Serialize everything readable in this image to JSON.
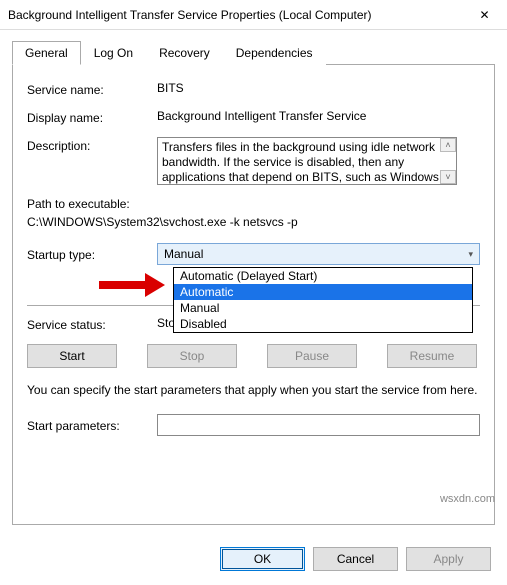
{
  "window": {
    "title": "Background Intelligent Transfer Service Properties (Local Computer)"
  },
  "tabs": {
    "general": "General",
    "logon": "Log On",
    "recovery": "Recovery",
    "dependencies": "Dependencies"
  },
  "labels": {
    "service_name": "Service name:",
    "display_name": "Display name:",
    "description": "Description:",
    "path_to_exe": "Path to executable:",
    "startup_type": "Startup type:",
    "service_status": "Service status:",
    "start_params": "Start parameters:"
  },
  "values": {
    "service_name": "BITS",
    "display_name": "Background Intelligent Transfer Service",
    "description": "Transfers files in the background using idle network bandwidth. If the service is disabled, then any applications that depend on BITS, such as Windows",
    "path": "C:\\WINDOWS\\System32\\svchost.exe -k netsvcs -p",
    "startup_type_selected": "Manual",
    "service_status": "Stopped",
    "start_params": ""
  },
  "dropdown": {
    "options": {
      "auto_delayed": "Automatic (Delayed Start)",
      "automatic": "Automatic",
      "manual": "Manual",
      "disabled": "Disabled"
    },
    "highlighted": "Automatic"
  },
  "buttons": {
    "start": "Start",
    "stop": "Stop",
    "pause": "Pause",
    "resume": "Resume",
    "ok": "OK",
    "cancel": "Cancel",
    "apply": "Apply"
  },
  "note": "You can specify the start parameters that apply when you start the service from here.",
  "watermark": "wsxdn.com"
}
